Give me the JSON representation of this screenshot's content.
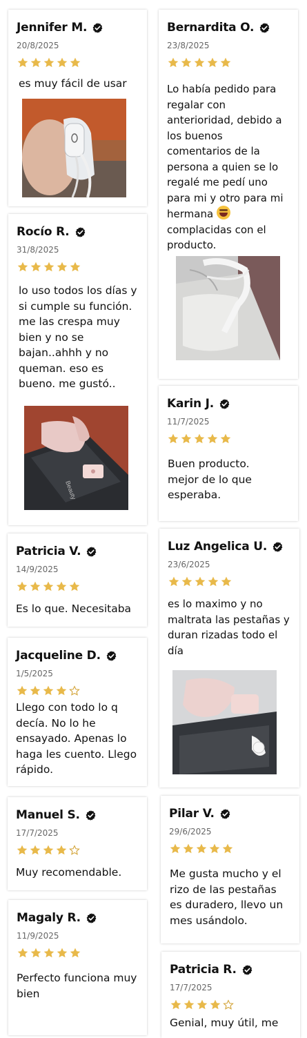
{
  "colors": {
    "star_gold": "#e8b94a",
    "star_empty": "#d4a63d",
    "verified": "#111111"
  },
  "reviews": [
    {
      "name": "Jennifer M.",
      "date": "20/8/2025",
      "rating": 5,
      "text": "es muy fácil de usar",
      "has_photo": true
    },
    {
      "name": "Bernardita O.",
      "date": "23/8/2025",
      "rating": 5,
      "text_before_emoji": "Lo había pedido para regalar con anterioridad, debido a los buenos comentarios de la persona a quien se lo regalé me pedí uno para mi y otro para mi hermana",
      "emoji_icon": "smiling-face-with-sweat-emoji",
      "text_after_emoji": "complacidas con el producto.",
      "has_photo": true
    },
    {
      "name": "Rocío R.",
      "date": "31/8/2025",
      "rating": 5,
      "text": "lo uso todos los días y si cumple su función. me las crespa muy bien y no se bajan..ahhh y no queman. eso es bueno. me gustó..",
      "has_photo": true
    },
    {
      "name": "Karin J.",
      "date": "11/7/2025",
      "rating": 5,
      "text": "Buen producto. mejor de lo que esperaba.",
      "has_photo": false
    },
    {
      "name": "Patricia V.",
      "date": "14/9/2025",
      "rating": 5,
      "text": "Es lo que. Necesitaba",
      "has_photo": false
    },
    {
      "name": "Luz Angelica U.",
      "date": "23/6/2025",
      "rating": 5,
      "text": "es lo maximo y no maltrata las pestañas y duran rizadas todo el día",
      "has_photo": true
    },
    {
      "name": "Jacqueline D.",
      "date": "1/5/2025",
      "rating": 4,
      "text": "Llego con todo lo q decía. No lo he ensayado. Apenas lo haga les cuento. Llego rápido.",
      "has_photo": false
    },
    {
      "name": "Manuel S.",
      "date": "17/7/2025",
      "rating": 4,
      "text": "Muy recomendable.",
      "has_photo": false
    },
    {
      "name": "Pilar V.",
      "date": "29/6/2025",
      "rating": 5,
      "text": "Me gusta mucho y el rizo de las pestañas es duradero, llevo un mes usándolo.",
      "has_photo": false
    },
    {
      "name": "Magaly R.",
      "date": "11/9/2025",
      "rating": 5,
      "text": "Perfecto funciona muy bien",
      "has_photo": false
    },
    {
      "name": "Patricia R.",
      "date": "17/7/2025",
      "rating": 4,
      "text": "Genial, muy útil, me",
      "has_photo": false
    }
  ]
}
